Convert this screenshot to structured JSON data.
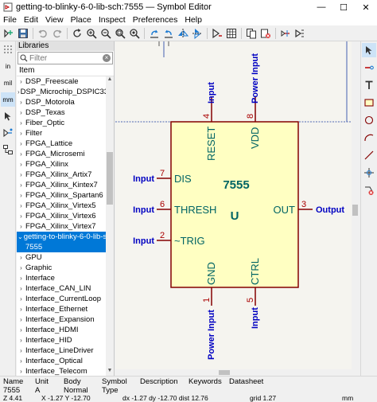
{
  "window": {
    "title": "getting-to-blinky-6-0-lib-sch:7555 — Symbol Editor",
    "buttons": {
      "minimize": "—",
      "maximize": "☐",
      "close": "✕"
    }
  },
  "menubar": [
    "File",
    "Edit",
    "View",
    "Place",
    "Inspect",
    "Preferences",
    "Help"
  ],
  "libraries_panel": {
    "title": "Libraries",
    "filter_placeholder": "Filter",
    "column_header": "Item",
    "items": [
      {
        "label": "DSP_Freescale",
        "expanded": false
      },
      {
        "label": "DSP_Microchip_DSPIC33",
        "expanded": false
      },
      {
        "label": "DSP_Motorola",
        "expanded": false
      },
      {
        "label": "DSP_Texas",
        "expanded": false
      },
      {
        "label": "Fiber_Optic",
        "expanded": false
      },
      {
        "label": "Filter",
        "expanded": false
      },
      {
        "label": "FPGA_Lattice",
        "expanded": false
      },
      {
        "label": "FPGA_Microsemi",
        "expanded": false
      },
      {
        "label": "FPGA_Xilinx",
        "expanded": false
      },
      {
        "label": "FPGA_Xilinx_Artix7",
        "expanded": false
      },
      {
        "label": "FPGA_Xilinx_Kintex7",
        "expanded": false
      },
      {
        "label": "FPGA_Xilinx_Spartan6",
        "expanded": false
      },
      {
        "label": "FPGA_Xilinx_Virtex5",
        "expanded": false
      },
      {
        "label": "FPGA_Xilinx_Virtex6",
        "expanded": false
      },
      {
        "label": "FPGA_Xilinx_Virtex7",
        "expanded": false
      },
      {
        "label": "getting-to-blinky-6-0-lib-sch",
        "expanded": true,
        "selected": true
      },
      {
        "label": "7555",
        "child": true,
        "selected": true
      },
      {
        "label": "GPU",
        "expanded": false
      },
      {
        "label": "Graphic",
        "expanded": false
      },
      {
        "label": "Interface",
        "expanded": false
      },
      {
        "label": "Interface_CAN_LIN",
        "expanded": false
      },
      {
        "label": "Interface_CurrentLoop",
        "expanded": false
      },
      {
        "label": "Interface_Ethernet",
        "expanded": false
      },
      {
        "label": "Interface_Expansion",
        "expanded": false
      },
      {
        "label": "Interface_HDMI",
        "expanded": false
      },
      {
        "label": "Interface_HID",
        "expanded": false
      },
      {
        "label": "Interface_LineDriver",
        "expanded": false
      },
      {
        "label": "Interface_Optical",
        "expanded": false
      },
      {
        "label": "Interface_Telecom",
        "expanded": false
      }
    ]
  },
  "left_toolbar": [
    "grid-icon",
    "in",
    "mil",
    "mm",
    "cursor-icon",
    "pin-table-icon",
    "hierarchy-icon"
  ],
  "symbol": {
    "name": "7555",
    "reference": "U",
    "pins": [
      {
        "number": "4",
        "name": "RESET",
        "type": "Input",
        "side": "top"
      },
      {
        "number": "8",
        "name": "VDD",
        "type": "Power Input",
        "side": "top"
      },
      {
        "number": "7",
        "name": "DIS",
        "type": "Input",
        "side": "left"
      },
      {
        "number": "6",
        "name": "THRESH",
        "type": "Input",
        "side": "left"
      },
      {
        "number": "2",
        "name": "~TRIG",
        "type": "Input",
        "side": "left"
      },
      {
        "number": "3",
        "name": "OUT",
        "type": "Output",
        "side": "right"
      },
      {
        "number": "1",
        "name": "GND",
        "type": "Power Input",
        "side": "bottom"
      },
      {
        "number": "5",
        "name": "CTRL",
        "type": "Input",
        "side": "bottom"
      }
    ],
    "colors": {
      "body_fill": "#ffffc2",
      "body_stroke": "#840000",
      "pin_stroke": "#840000",
      "pin_number": "#a90000",
      "pin_name": "#006464",
      "electrical_type": "#0000c2",
      "field_text": "#006464"
    }
  },
  "info": {
    "headers": [
      "Name",
      "Unit",
      "Body",
      "Symbol",
      "Description",
      "Keywords",
      "Datasheet"
    ],
    "values": [
      "7555",
      "A",
      "Normal",
      "Type",
      "",
      "",
      ""
    ]
  },
  "status": {
    "zoom": "Z 4.41",
    "xy": "X -1.27  Y -12.70",
    "delta": "dx -1.27  dy -12.70  dist 12.76",
    "grid": "grid 1.27",
    "units": "mm"
  }
}
